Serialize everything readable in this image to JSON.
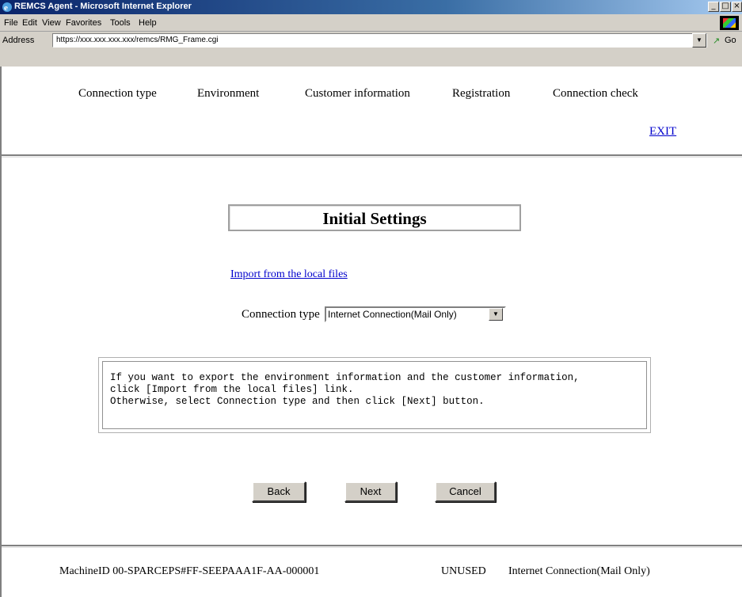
{
  "window": {
    "title": "REMCS Agent - Microsoft Internet Explorer",
    "controls": {
      "minimize": "_",
      "maximize": "□",
      "close": "×"
    }
  },
  "menubar": {
    "items": [
      {
        "label": "File"
      },
      {
        "label": "Edit"
      },
      {
        "label": "View"
      },
      {
        "label": "Favorites"
      },
      {
        "label": "Tools"
      },
      {
        "label": "Help"
      }
    ]
  },
  "addressbar": {
    "label": "Address",
    "url": "https://xxx.xxx.xxx.xxx/remcs/RMG_Frame.cgi",
    "go_label": "Go",
    "go_icon": "go-arrow-icon",
    "dropdown_glyph": "▼"
  },
  "steps": [
    {
      "label": "Connection type"
    },
    {
      "label": "Environment"
    },
    {
      "label": "Customer information"
    },
    {
      "label": "Registration"
    },
    {
      "label": "Connection check"
    }
  ],
  "exit_label": "EXIT",
  "main": {
    "heading": "Initial Settings",
    "import_link": "Import from the local files",
    "connection_label": "Connection type",
    "connection_value": "Internet Connection(Mail Only)",
    "message_lines": [
      "If you want to export the environment information and the customer information,",
      "click [Import from the local files] link.",
      "Otherwise, select Connection type and then click [Next] button."
    ],
    "buttons": {
      "back": "Back",
      "next": "Next",
      "cancel": "Cancel"
    }
  },
  "footer": {
    "machine_id": "MachineID  00-SPARCEPS#FF-SEEPAAA1F-AA-000001",
    "status": "UNUSED",
    "connection": "Internet Connection(Mail Only)"
  },
  "colors": {
    "titlebar": "#0a246a",
    "chrome": "#d4d0c8",
    "link": "#0000cc"
  }
}
